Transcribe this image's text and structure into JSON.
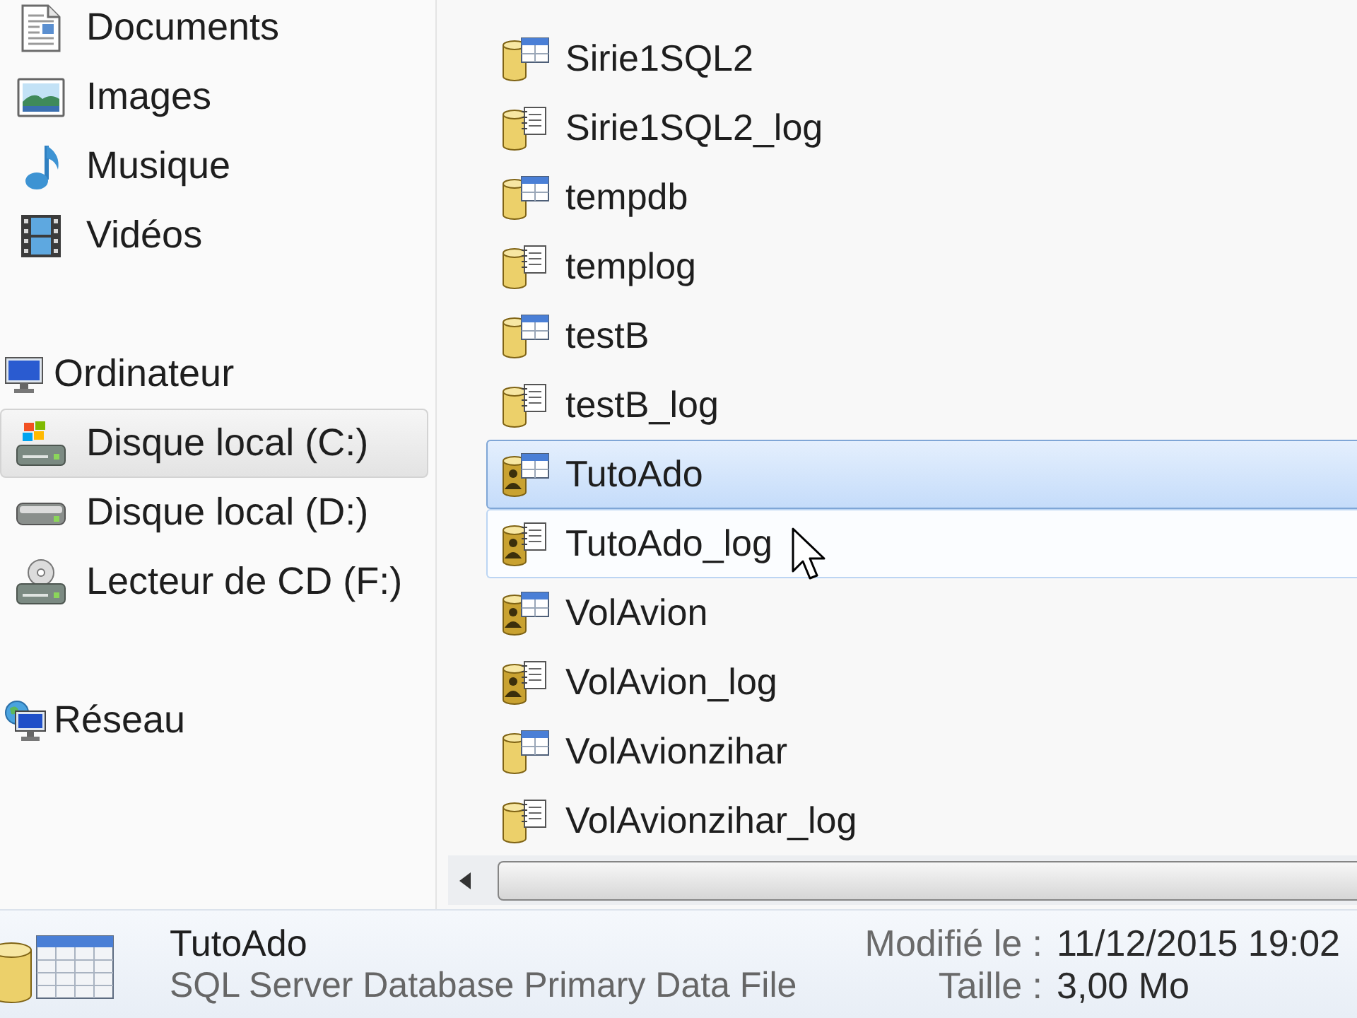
{
  "navigation": {
    "library_items": [
      {
        "label": "Documents",
        "kind": "documents",
        "selected": false
      },
      {
        "label": "Images",
        "kind": "images",
        "selected": false
      },
      {
        "label": "Musique",
        "kind": "music",
        "selected": false
      },
      {
        "label": "Vidéos",
        "kind": "videos",
        "selected": false
      }
    ],
    "tree": [
      {
        "label": "Ordinateur",
        "kind": "computer",
        "selected": false,
        "children": [
          {
            "label": "Disque local (C:)",
            "kind": "system_drive",
            "selected": true
          },
          {
            "label": "Disque local (D:)",
            "kind": "drive",
            "selected": false
          },
          {
            "label": "Lecteur de CD (F:)",
            "kind": "cd_drive",
            "selected": false
          }
        ]
      },
      {
        "label": "Réseau",
        "kind": "network",
        "selected": false
      }
    ]
  },
  "file_list": {
    "rows": [
      {
        "name": "Sirie1SQL2",
        "kind": "data",
        "restricted": false,
        "selected": false,
        "hovered": false
      },
      {
        "name": "Sirie1SQL2_log",
        "kind": "log",
        "restricted": false,
        "selected": false,
        "hovered": false
      },
      {
        "name": "tempdb",
        "kind": "data",
        "restricted": false,
        "selected": false,
        "hovered": false
      },
      {
        "name": "templog",
        "kind": "log",
        "restricted": false,
        "selected": false,
        "hovered": false
      },
      {
        "name": "testB",
        "kind": "data",
        "restricted": false,
        "selected": false,
        "hovered": false
      },
      {
        "name": "testB_log",
        "kind": "log",
        "restricted": false,
        "selected": false,
        "hovered": false
      },
      {
        "name": "TutoAdo",
        "kind": "data",
        "restricted": true,
        "selected": true,
        "hovered": false
      },
      {
        "name": "TutoAdo_log",
        "kind": "log",
        "restricted": true,
        "selected": false,
        "hovered": true
      },
      {
        "name": "VolAvion",
        "kind": "data",
        "restricted": true,
        "selected": false,
        "hovered": false
      },
      {
        "name": "VolAvion_log",
        "kind": "log",
        "restricted": true,
        "selected": false,
        "hovered": false
      },
      {
        "name": "VolAvionzihar",
        "kind": "data",
        "restricted": false,
        "selected": false,
        "hovered": false
      },
      {
        "name": "VolAvionzihar_log",
        "kind": "log",
        "restricted": false,
        "selected": false,
        "hovered": false
      }
    ]
  },
  "details_pane": {
    "name": "TutoAdo",
    "type": "SQL Server Database Primary Data File",
    "properties": [
      {
        "label": "Modifié le :",
        "value": "11/12/2015 19:02"
      },
      {
        "label": "Taille :",
        "value": "3,00 Mo"
      }
    ]
  }
}
